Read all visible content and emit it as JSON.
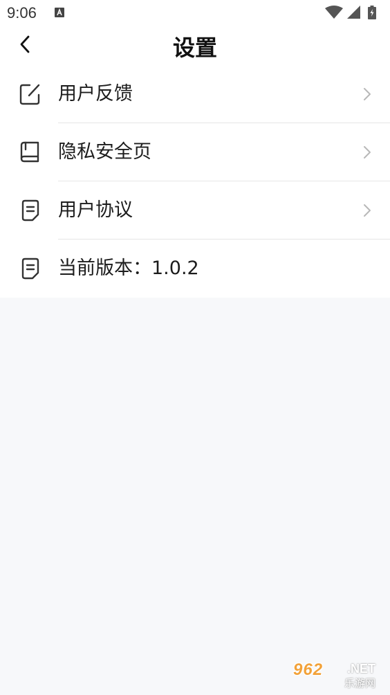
{
  "status_bar": {
    "time": "9:06",
    "icons": [
      "a-notification-icon",
      "wifi-icon",
      "signal-icon",
      "battery-icon"
    ]
  },
  "header": {
    "title": "设置",
    "back_icon": "chevron-left-icon"
  },
  "menu": {
    "items": [
      {
        "label": "用户反馈",
        "icon": "edit-note-icon",
        "has_chevron": true
      },
      {
        "label": "隐私安全页",
        "icon": "book-icon",
        "has_chevron": true
      },
      {
        "label": "用户协议",
        "icon": "document-icon",
        "has_chevron": true
      },
      {
        "label": "当前版本：1.0.2",
        "icon": "document-icon",
        "has_chevron": false
      }
    ]
  },
  "watermark": {
    "main": "962",
    "net": ".NET",
    "sub": "乐游网"
  },
  "colors": {
    "background": "#f7f8fa",
    "surface": "#ffffff",
    "text": "#1c1c1c",
    "divider": "#e6e6e6",
    "chevron": "#b8b8b8"
  }
}
